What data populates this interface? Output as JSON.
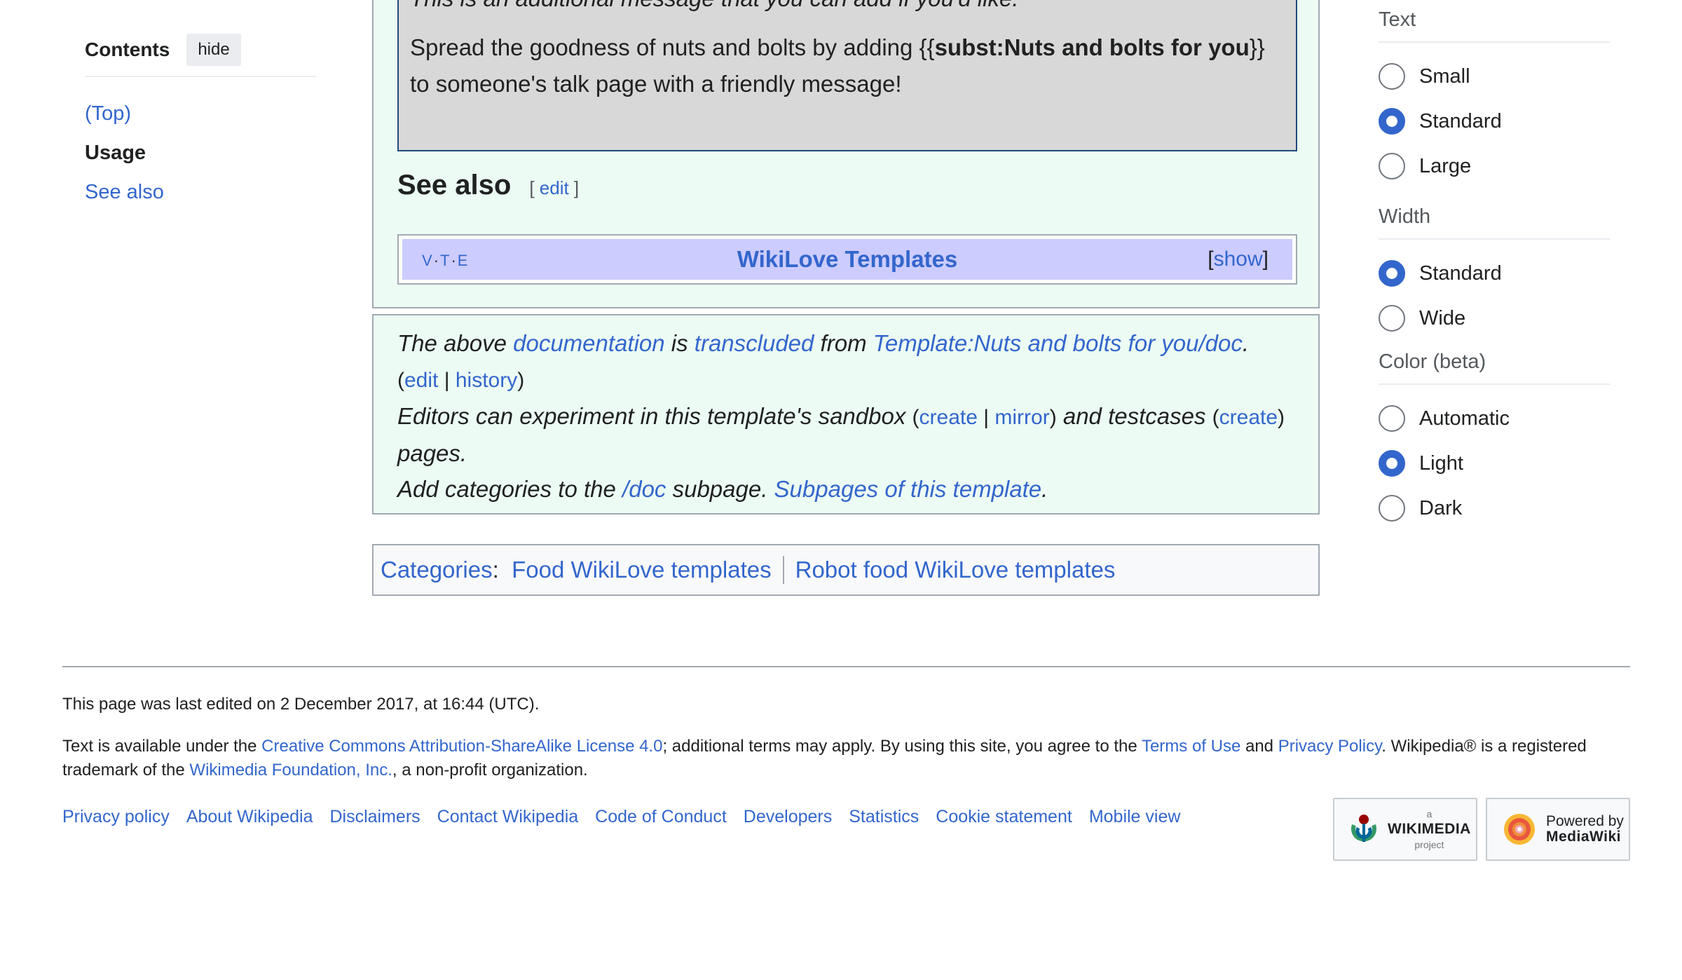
{
  "toc": {
    "title": "Contents",
    "hide_label": "hide",
    "items": [
      {
        "label": "(Top)"
      },
      {
        "label": "Usage"
      },
      {
        "label": "See also"
      }
    ]
  },
  "main": {
    "italic_message": "This is an additional message that you can add if you'd like.",
    "spread_prefix": "Spread the goodness of nuts and bolts by adding {{",
    "spread_bold": "subst:Nuts and bolts for you",
    "spread_suffix": "}} to someone's talk page with a friendly message!",
    "see_also_heading": "See also",
    "edit_open": "[ ",
    "edit_label": "edit",
    "edit_close": " ]",
    "navbox": {
      "v": "V",
      "t": "T",
      "e": "E",
      "dot": "·",
      "title": "WikiLove Templates",
      "show_open": "[",
      "show_label": "show",
      "show_close": "]"
    }
  },
  "doc_footer": {
    "l1_a": "The above ",
    "l1_documentation": "documentation",
    "l1_b": " is ",
    "l1_transcluded": "transcluded",
    "l1_c": " from ",
    "l1_template": "Template:Nuts and bolts for you/doc",
    "l1_d": ". ",
    "edit": "edit",
    "history": "history",
    "l2_a": "Editors can experiment in this template's sandbox ",
    "create": "create",
    "mirror": "mirror",
    "l2_b": " and testcases ",
    "l2_c": " pages.",
    "l3_a": "Add categories to the ",
    "l3_doc": "/doc",
    "l3_b": " subpage. ",
    "l3_subpages": "Subpages of this template",
    "l3_c": "."
  },
  "categories": {
    "label": "Categories",
    "items": [
      "Food WikiLove templates",
      "Robot food WikiLove templates"
    ]
  },
  "appearance": {
    "groups": [
      {
        "title": "Text",
        "options": [
          {
            "label": "Small",
            "checked": false
          },
          {
            "label": "Standard",
            "checked": true
          },
          {
            "label": "Large",
            "checked": false
          }
        ]
      },
      {
        "title": "Width",
        "options": [
          {
            "label": "Standard",
            "checked": true
          },
          {
            "label": "Wide",
            "checked": false
          }
        ]
      },
      {
        "title": "Color (beta)",
        "options": [
          {
            "label": "Automatic",
            "checked": false
          },
          {
            "label": "Light",
            "checked": true
          },
          {
            "label": "Dark",
            "checked": false
          }
        ]
      }
    ]
  },
  "footer": {
    "last_edited": "This page was last edited on 2 December 2017, at 16:44 (UTC).",
    "license_a": "Text is available under the ",
    "license_link": "Creative Commons Attribution-ShareAlike License 4.0",
    "license_b": "; additional terms may apply. By using this site, you agree to the ",
    "terms_link": "Terms of Use",
    "license_c": " and ",
    "privacy_link": "Privacy Policy",
    "license_d": ". Wikipedia® is a registered trademark of the ",
    "foundation_link": "Wikimedia Foundation, Inc.",
    "license_e": ", a non-profit organization.",
    "links": [
      "Privacy policy",
      "About Wikipedia",
      "Disclaimers",
      "Contact Wikipedia",
      "Code of Conduct",
      "Developers",
      "Statistics",
      "Cookie statement",
      "Mobile view"
    ],
    "wikimedia_badge": {
      "small": "a",
      "name": "WIKIMEDIA",
      "sub": "project"
    },
    "mediawiki_badge": {
      "line1": "Powered by",
      "line2": "MediaWiki"
    }
  }
}
